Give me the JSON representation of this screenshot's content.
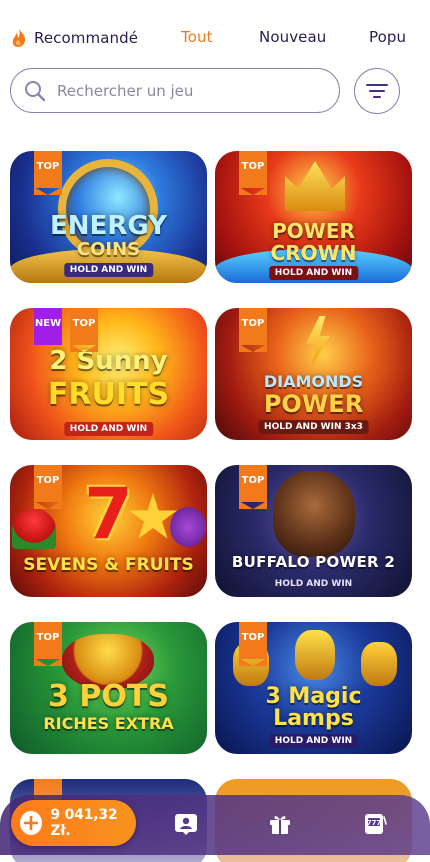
{
  "tabs": [
    {
      "label": "Recommandé",
      "active": false
    },
    {
      "label": "Tout",
      "active": true
    },
    {
      "label": "Nouveau",
      "active": false
    },
    {
      "label": "Popu",
      "active": false
    }
  ],
  "search": {
    "placeholder": "Rechercher un jeu",
    "value": ""
  },
  "games": [
    {
      "title_line1": "ENERGY",
      "title_line2": "COINS",
      "subtitle": "HOLD AND WIN",
      "badges": [
        "TOP"
      ]
    },
    {
      "title_line1": "POWER",
      "title_line2": "CROWN",
      "subtitle": "HOLD AND WIN",
      "badges": [
        "TOP"
      ]
    },
    {
      "title_line1": "2 Sunny",
      "title_line2": "FRUITS",
      "subtitle": "HOLD AND WIN",
      "badges": [
        "NEW",
        "TOP"
      ]
    },
    {
      "title_line1": "DIAMONDS",
      "title_line2": "POWER",
      "subtitle": "HOLD AND WIN 3x3",
      "badges": [
        "TOP"
      ]
    },
    {
      "title_line1": "7",
      "title_line2": "SEVENS & FRUITS",
      "subtitle": "",
      "badges": [
        "TOP"
      ]
    },
    {
      "title_line1": "BUFFALO POWER 2",
      "title_line2": "",
      "subtitle": "HOLD AND WIN",
      "badges": [
        "TOP"
      ]
    },
    {
      "title_line1": "3 POTS",
      "title_line2": "RICHES EXTRA",
      "subtitle": "",
      "badges": [
        "TOP"
      ]
    },
    {
      "title_line1": "3 Magic",
      "title_line2": "Lamps",
      "subtitle": "HOLD AND WIN",
      "badges": [
        "TOP"
      ]
    }
  ],
  "bottom_bar": {
    "balance": "9 041,32 Zł.",
    "icons": [
      "profile-icon",
      "gift-icon",
      "slots-icon"
    ]
  },
  "colors": {
    "accent": "#f07a1e",
    "text": "#2b1d4e",
    "border": "#8e7fb0",
    "nav": "#4b2d80"
  }
}
